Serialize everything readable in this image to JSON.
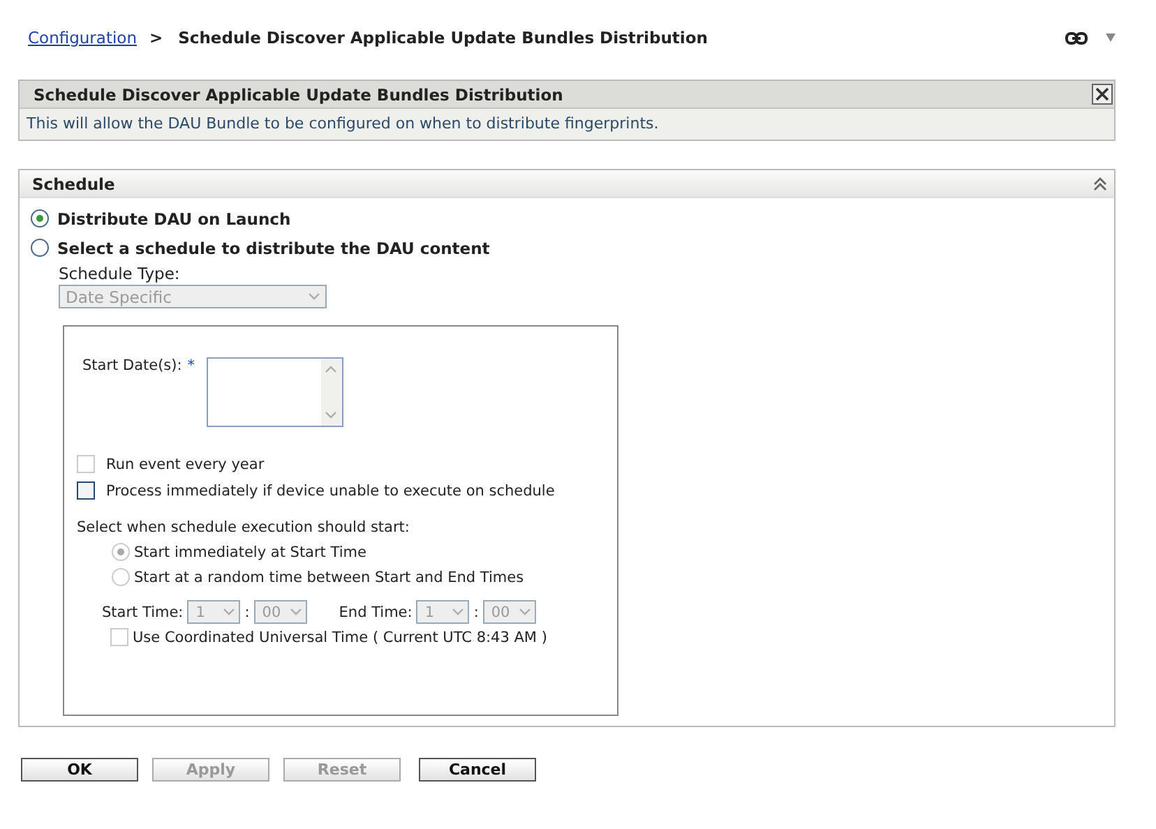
{
  "breadcrumb": {
    "link": "Configuration",
    "separator": ">",
    "current": "Schedule Discover Applicable Update Bundles Distribution"
  },
  "info_panel": {
    "title": "Schedule Discover Applicable Update Bundles Distribution",
    "text": "This will allow the DAU Bundle to be configured on when to distribute fingerprints."
  },
  "schedule": {
    "title": "Schedule",
    "options": [
      {
        "label": "Distribute DAU on Launch",
        "selected": true
      },
      {
        "label": "Select a schedule to distribute the DAU content",
        "selected": false
      }
    ],
    "schedule_type": {
      "label": "Schedule Type:",
      "value": "Date Specific",
      "disabled": true
    },
    "start_dates": {
      "label": "Start Date(s):",
      "required_mark": "*"
    },
    "checkboxes": [
      {
        "label": "Run event every year",
        "checked": false,
        "disabled": true
      },
      {
        "label": "Process immediately if device unable to execute on schedule",
        "checked": false,
        "disabled": false
      }
    ],
    "start_mode": {
      "label": "Select when schedule execution should start:",
      "options": [
        {
          "label": "Start immediately at Start Time",
          "selected": true,
          "disabled": true
        },
        {
          "label": "Start at a random time between Start and End Times",
          "selected": false,
          "disabled": true
        }
      ]
    },
    "times": [
      {
        "label": "Start Time:",
        "hour": "1",
        "separator": ":",
        "minute": "00"
      },
      {
        "label": "End Time:",
        "hour": "1",
        "separator": ":",
        "minute": "00"
      }
    ],
    "utc": {
      "label": "Use Coordinated Universal Time ( Current UTC 8:43 AM )",
      "checked": false,
      "disabled": true
    }
  },
  "buttons": [
    {
      "label": "OK",
      "disabled": false
    },
    {
      "label": "Apply",
      "disabled": true
    },
    {
      "label": "Reset",
      "disabled": true
    },
    {
      "label": "Cancel",
      "disabled": false
    }
  ]
}
